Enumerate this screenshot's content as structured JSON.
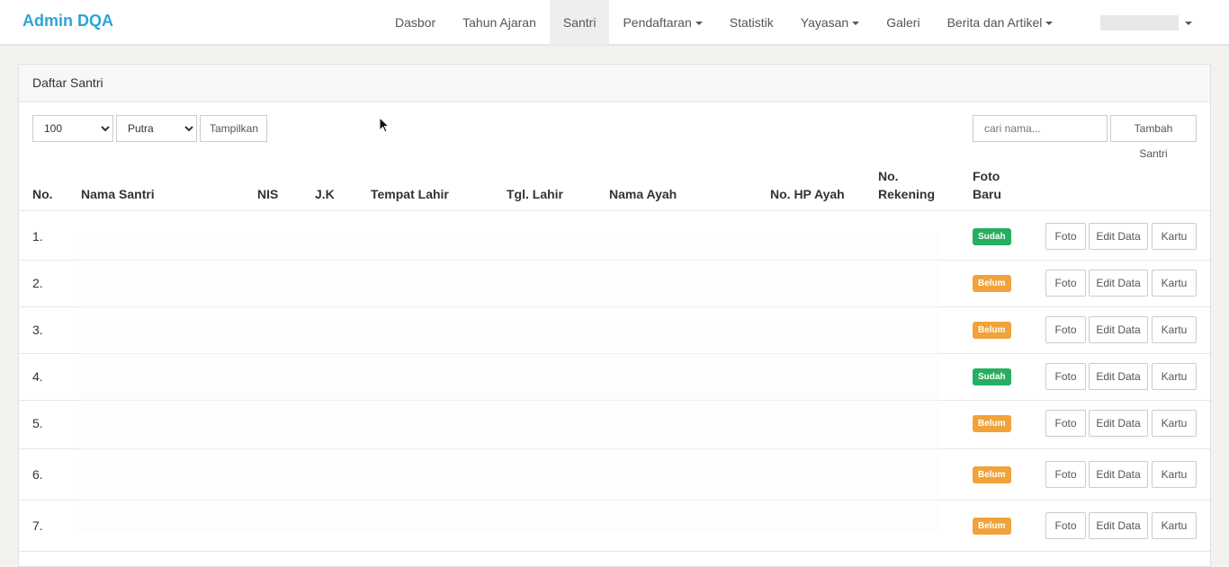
{
  "app": {
    "brand": "Admin DQA"
  },
  "nav": [
    {
      "label": "Dasbor",
      "active": false,
      "dropdown": false
    },
    {
      "label": "Tahun Ajaran",
      "active": false,
      "dropdown": false
    },
    {
      "label": "Santri",
      "active": true,
      "dropdown": false
    },
    {
      "label": "Pendaftaran",
      "active": false,
      "dropdown": true
    },
    {
      "label": "Statistik",
      "active": false,
      "dropdown": false
    },
    {
      "label": "Yayasan",
      "active": false,
      "dropdown": true
    },
    {
      "label": "Galeri",
      "active": false,
      "dropdown": false
    },
    {
      "label": "Berita dan Artikel",
      "active": false,
      "dropdown": true
    }
  ],
  "panel": {
    "title": "Daftar Santri"
  },
  "filters": {
    "limit": "100",
    "gender": "Putra",
    "show_label": "Tampilkan",
    "search_placeholder": "cari nama...",
    "add_label": "Tambah Santri"
  },
  "table": {
    "headers": {
      "no": "No.",
      "nama": "Nama Santri",
      "nis": "NIS",
      "jk": "J.K",
      "tempat": "Tempat Lahir",
      "tgl": "Tgl. Lahir",
      "ayah": "Nama Ayah",
      "hp": "No. HP Ayah",
      "rek_1": "No.",
      "rek_2": "Rekening",
      "foto_1": "Foto",
      "foto_2": "Baru"
    },
    "rows": [
      {
        "no": "1.",
        "status": "Sudah"
      },
      {
        "no": "2.",
        "status": "Belum"
      },
      {
        "no": "3.",
        "status": "Belum"
      },
      {
        "no": "4.",
        "status": "Sudah"
      },
      {
        "no": "5.",
        "status": "Belum"
      },
      {
        "no": "6.",
        "status": "Belum"
      },
      {
        "no": "7.",
        "status": "Belum"
      }
    ],
    "actions": {
      "foto": "Foto",
      "edit": "Edit Data",
      "kartu": "Kartu"
    }
  },
  "colors": {
    "brand": "#2ba5d8",
    "sudah": "#27ae60",
    "belum": "#f0a33a"
  }
}
